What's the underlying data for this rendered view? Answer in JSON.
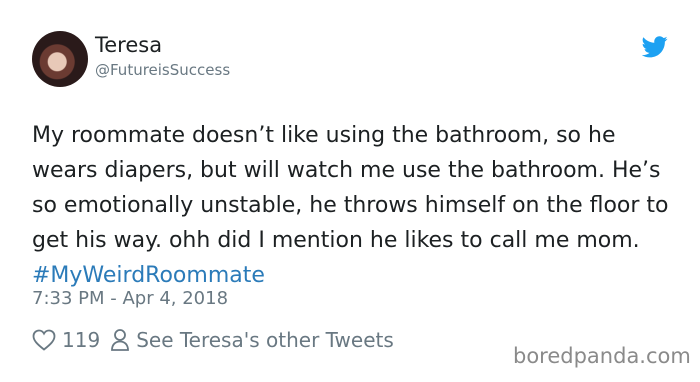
{
  "author": {
    "name": "Teresa",
    "handle": "@FutureisSuccess"
  },
  "tweet": {
    "text_main": "My roommate doesn’t like using the bathroom, so he wears diapers, but will watch me use the bathroom. He’s so emotionally unstable, he throws himself on the floor to get his way. ohh did I mention he likes to call me mom.  ",
    "hashtag": "#MyWeirdRoommate",
    "timestamp": "7:33 PM - Apr 4, 2018"
  },
  "actions": {
    "like_count": "119",
    "other_tweets_label": "See Teresa's other Tweets"
  },
  "watermark": "boredpanda.com",
  "colors": {
    "link": "#2b7bb9",
    "twitter_blue": "#1da1f2",
    "muted": "#697882"
  },
  "icons": [
    "twitter-bird-icon",
    "heart-icon",
    "person-icon"
  ]
}
